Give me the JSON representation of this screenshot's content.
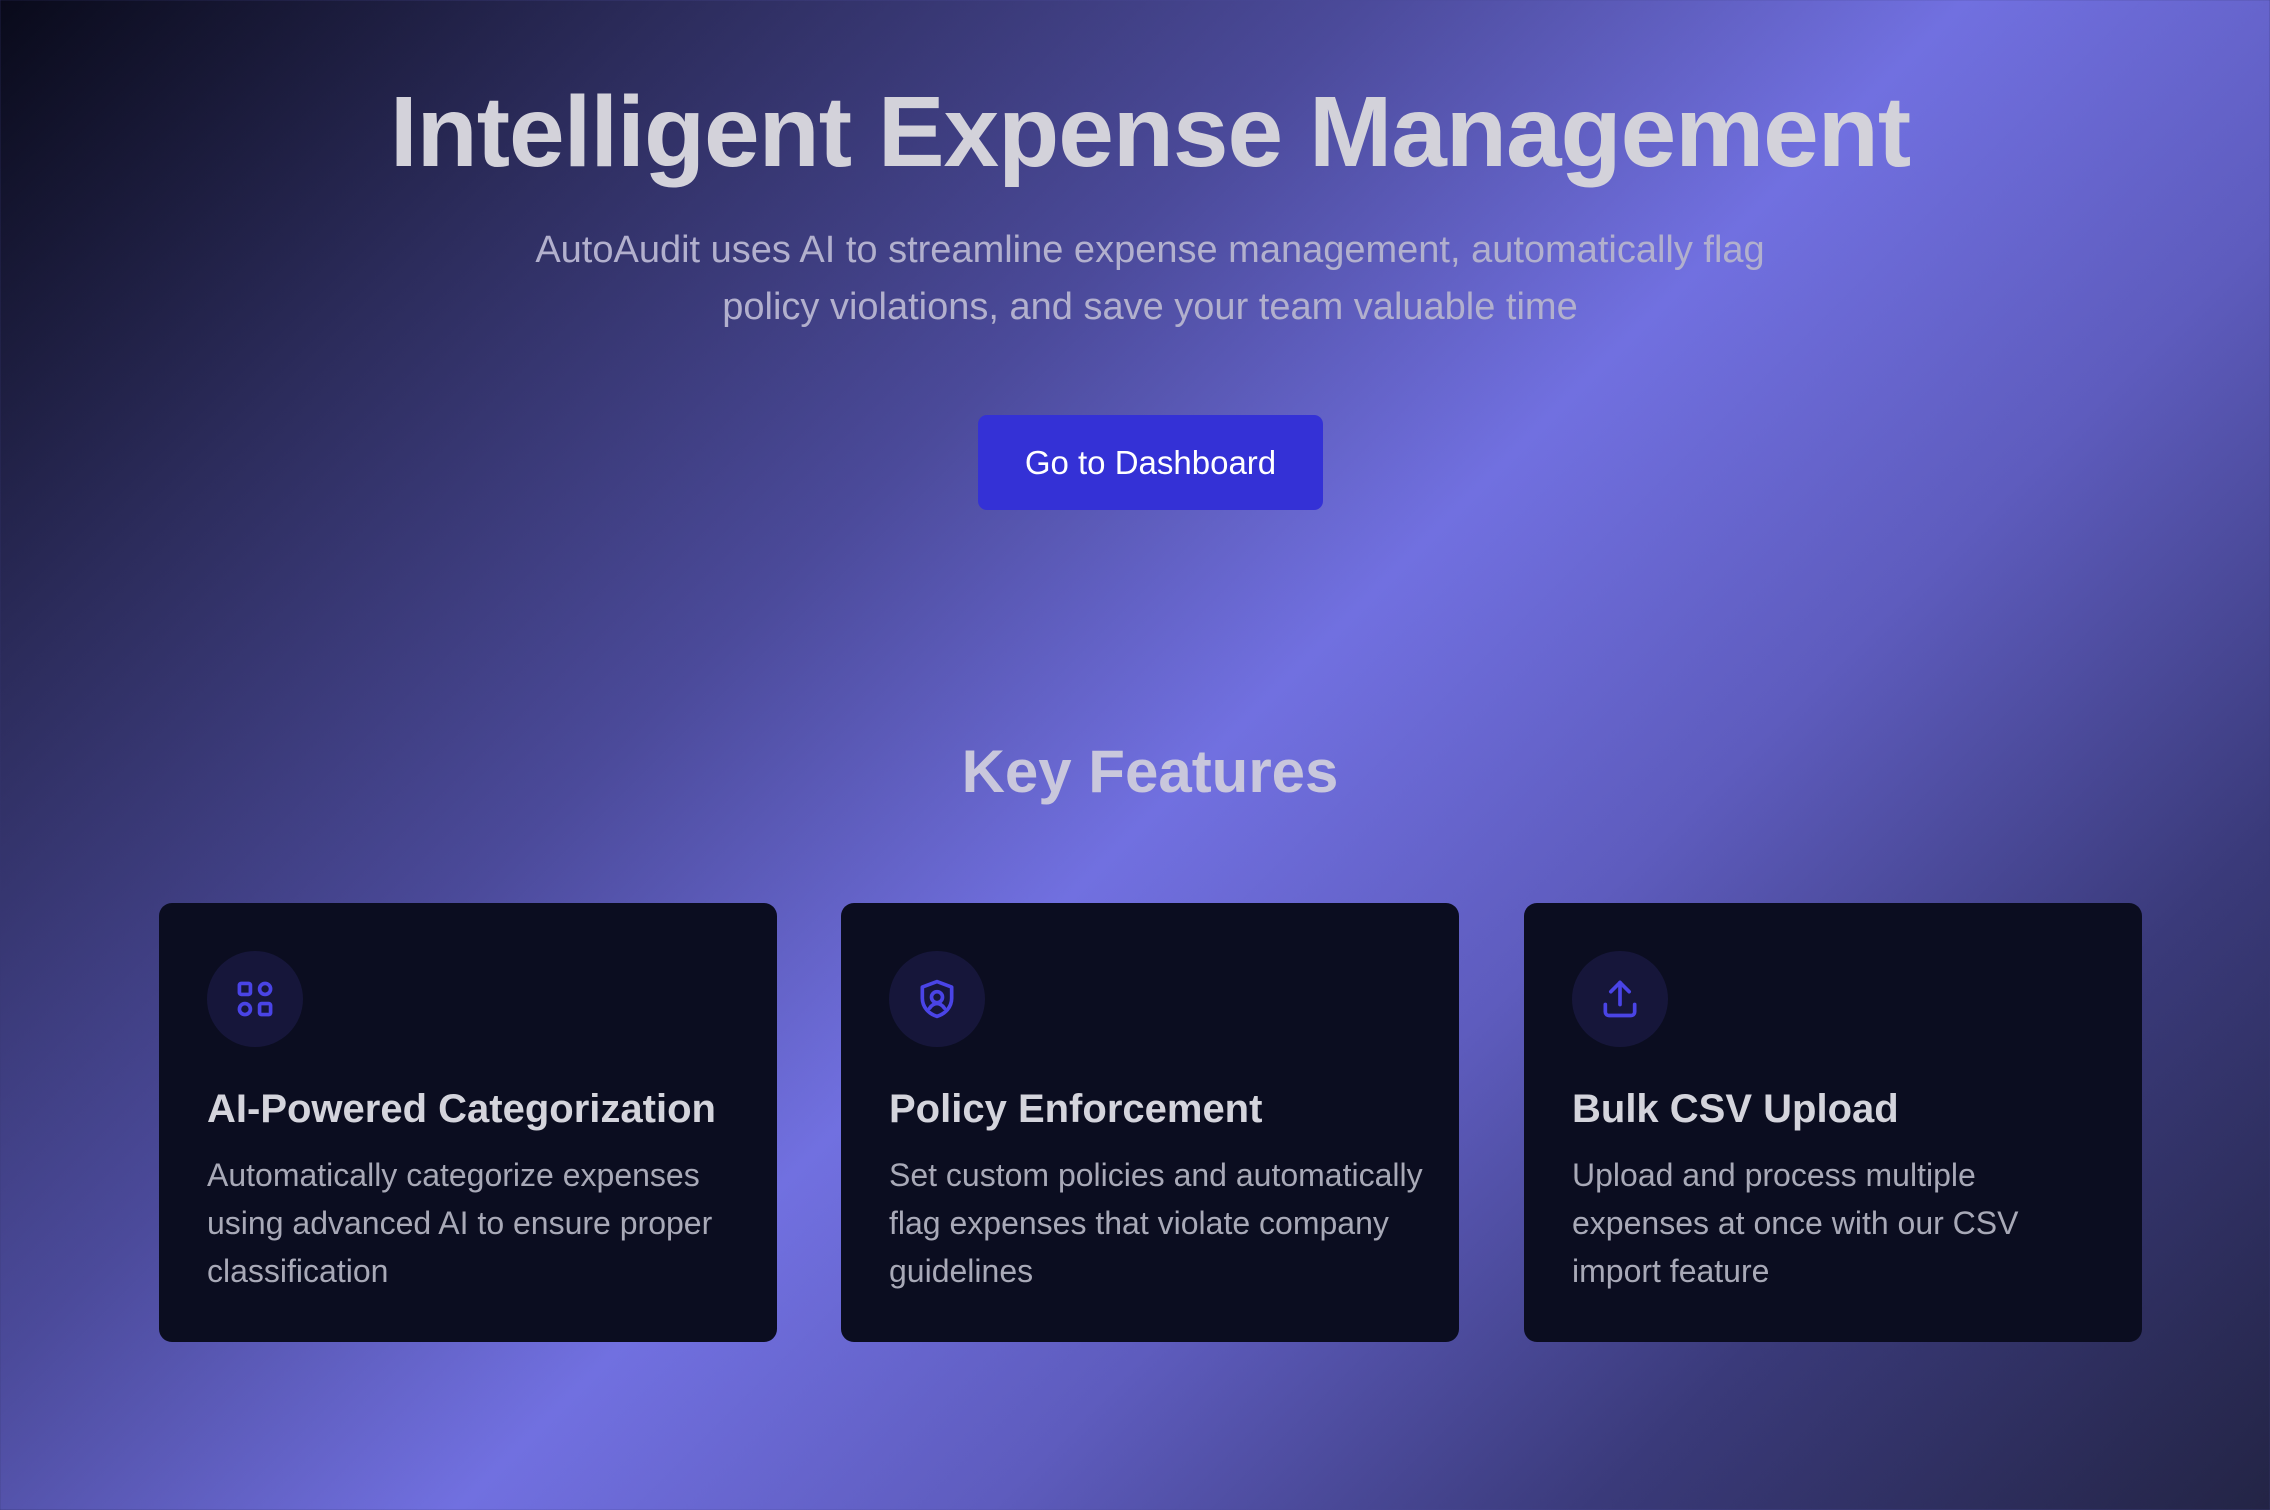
{
  "hero": {
    "title": "Intelligent Expense Management",
    "subtitle": "AutoAudit uses AI to streamline expense management, automatically flag policy violations, and save your team valuable time",
    "cta_label": "Go to Dashboard"
  },
  "features": {
    "title": "Key Features",
    "cards": [
      {
        "icon": "grid-squares-icon",
        "title": "AI-Powered Categorization",
        "description": "Automatically categorize expenses using advanced AI to ensure proper classification"
      },
      {
        "icon": "shield-icon",
        "title": "Policy Enforcement",
        "description": "Set custom policies and automatically flag expenses that violate company guidelines"
      },
      {
        "icon": "upload-icon",
        "title": "Bulk CSV Upload",
        "description": "Upload and process multiple expenses at once with our CSV import feature"
      }
    ]
  },
  "colors": {
    "accent": "#3431d6",
    "card_background": "#0b0d20",
    "icon_color": "#4a44e6"
  }
}
